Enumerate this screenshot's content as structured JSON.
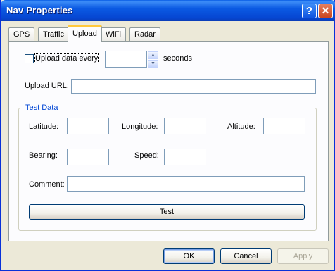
{
  "window": {
    "title": "Nav Properties"
  },
  "titlebar": {
    "help_glyph": "?",
    "close_glyph": "✕"
  },
  "tabs": [
    {
      "label": "GPS"
    },
    {
      "label": "Traffic"
    },
    {
      "label": "Upload",
      "active": true
    },
    {
      "label": "WiFi"
    },
    {
      "label": "Radar"
    }
  ],
  "upload": {
    "upload_every_label": "Upload data every",
    "upload_every_checked": false,
    "interval_value": "",
    "seconds_label": "seconds",
    "url_label": "Upload URL:",
    "url_value": ""
  },
  "test_data": {
    "group_title": "Test Data",
    "latitude_label": "Latitude:",
    "longitude_label": "Longitude:",
    "altitude_label": "Altitude:",
    "bearing_label": "Bearing:",
    "speed_label": "Speed:",
    "comment_label": "Comment:",
    "latitude_value": "",
    "longitude_value": "",
    "altitude_value": "",
    "bearing_value": "",
    "speed_value": "",
    "comment_value": "",
    "test_button": "Test"
  },
  "footer": {
    "ok": "OK",
    "cancel": "Cancel",
    "apply": "Apply"
  },
  "colors": {
    "titlebar": "#0b5ae3",
    "group_title": "#0046d5",
    "active_tab_accent": "#ffc83c"
  }
}
